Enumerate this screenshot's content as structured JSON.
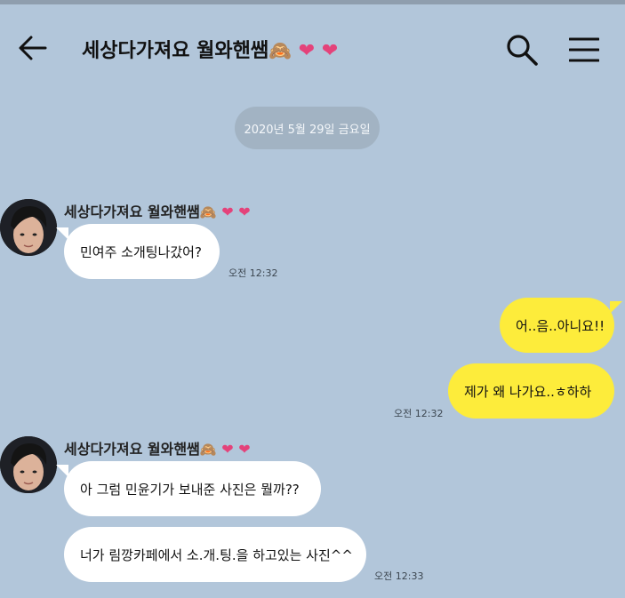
{
  "header": {
    "title_text": "세상다가져요 월와핸쌤",
    "title_emoji": "🙈",
    "hearts": "❤ ❤"
  },
  "date_divider": "2020년 5월 29일 금요일",
  "messages": [
    {
      "sender_name": "세상다가져요 월와핸쌤",
      "sender_emoji": "🙈",
      "sender_hearts": "❤ ❤",
      "bubbles": [
        "민여주 소개팅나갔어?"
      ],
      "time": "오전 12:32"
    },
    {
      "outgoing": true,
      "bubbles": [
        "어..음..아니요!!",
        "제가 왜 나가요..ㅎ하하"
      ],
      "time": "오전 12:32"
    },
    {
      "sender_name": "세상다가져요 월와핸쌤",
      "sender_emoji": "🙈",
      "sender_hearts": "❤ ❤",
      "bubbles": [
        "아 그럼 민윤기가 보내준 사진은 뭘까??",
        "너가 림깡카페에서 소.개.팅.을 하고있는 사진^^"
      ],
      "time": "오전 12:33"
    }
  ],
  "colors": {
    "background": "#b2c6da",
    "incoming_bubble": "#ffffff",
    "outgoing_bubble": "#fdec3b",
    "heart": "#e4427a",
    "date_pill": "#a2b3c3"
  },
  "icons": [
    "back-arrow-icon",
    "search-icon",
    "menu-icon"
  ]
}
